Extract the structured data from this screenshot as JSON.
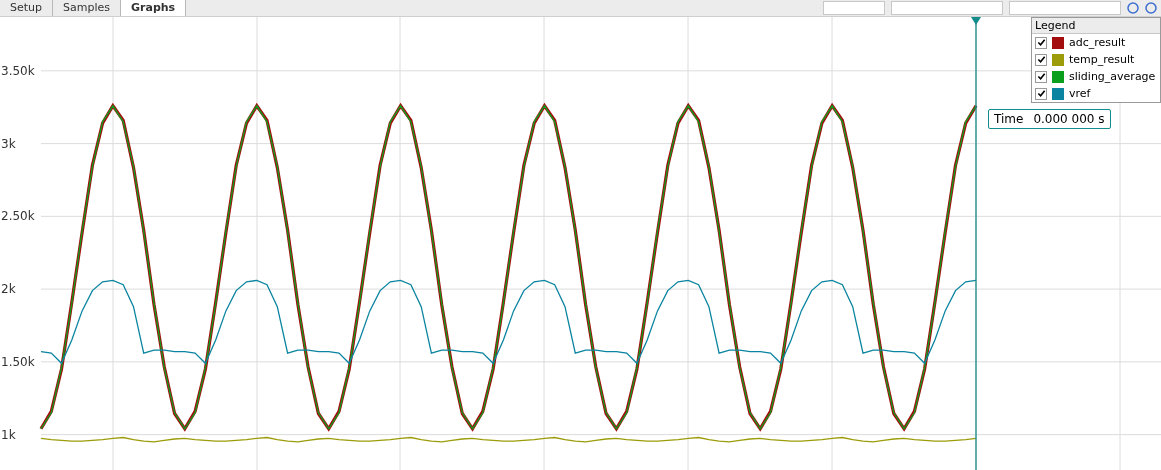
{
  "tabs": [
    {
      "label": "Setup",
      "selected": false
    },
    {
      "label": "Samples",
      "selected": false
    },
    {
      "label": "Graphs",
      "selected": true
    }
  ],
  "legend": {
    "title": "Legend",
    "items": [
      {
        "checked": true
      },
      {
        "checked": true
      },
      {
        "checked": true
      },
      {
        "checked": true
      }
    ]
  },
  "cursor": {
    "label": "Time",
    "value": "0.000 000 s"
  },
  "chart_data": {
    "type": "line",
    "grid": true,
    "ylim": [
      750,
      3870
    ],
    "yticks": [
      {
        "value": 1000,
        "label": "1k"
      },
      {
        "value": 1500,
        "label": "1.50k"
      },
      {
        "value": 2000,
        "label": "2k"
      },
      {
        "value": 2500,
        "label": "2.50k"
      },
      {
        "value": 3000,
        "label": "3k"
      },
      {
        "value": 3500,
        "label": "3.50k"
      }
    ],
    "series": [
      {
        "name": "adc_result",
        "color": "#a30d0d",
        "values": [
          1040,
          1160,
          1450,
          1910,
          2390,
          2850,
          3140,
          3260,
          3160,
          2835,
          2405,
          1895,
          1465,
          1145,
          1040,
          1160,
          1450,
          1910,
          2390,
          2850,
          3140,
          3260,
          3160,
          2835,
          2405,
          1895,
          1465,
          1145,
          1040,
          1160,
          1450,
          1910,
          2390,
          2850,
          3140,
          3260,
          3160,
          2835,
          2405,
          1895,
          1465,
          1145,
          1040,
          1160,
          1450,
          1910,
          2390,
          2850,
          3140,
          3260,
          3160,
          2835,
          2405,
          1895,
          1465,
          1145,
          1040,
          1160,
          1450,
          1910,
          2390,
          2850,
          3140,
          3260,
          3160,
          2835,
          2405,
          1895,
          1465,
          1145,
          1040,
          1160,
          1450,
          1910,
          2390,
          2850,
          3140,
          3260,
          3160,
          2835,
          2405,
          1895,
          1465,
          1145,
          1040,
          1160,
          1450,
          1910,
          2390,
          2850,
          3140,
          3260
        ]
      },
      {
        "name": "temp_result",
        "color": "#9c9c0a",
        "values": [
          975,
          965,
          960,
          955,
          955,
          960,
          965,
          975,
          980,
          965,
          955,
          950,
          960,
          970,
          975,
          965,
          960,
          955,
          955,
          960,
          965,
          975,
          980,
          965,
          955,
          950,
          960,
          970,
          975,
          965,
          960,
          955,
          955,
          960,
          965,
          975,
          980,
          965,
          955,
          950,
          960,
          970,
          975,
          965,
          960,
          955,
          955,
          960,
          965,
          975,
          980,
          965,
          955,
          950,
          960,
          970,
          975,
          965,
          960,
          955,
          955,
          960,
          965,
          975,
          980,
          965,
          955,
          950,
          960,
          970,
          975,
          965,
          960,
          955,
          955,
          960,
          965,
          975,
          980,
          965,
          955,
          950,
          960,
          970,
          975,
          965,
          960,
          955,
          955,
          960,
          965,
          975
        ]
      },
      {
        "name": "sliding_average",
        "color": "#0aa01e",
        "values": [
          1040,
          1150,
          1458,
          1902,
          2398,
          2842,
          3150,
          3260,
          3150,
          2842,
          2398,
          1902,
          1458,
          1150,
          1040,
          1150,
          1458,
          1902,
          2398,
          2842,
          3150,
          3260,
          3150,
          2842,
          2398,
          1902,
          1458,
          1150,
          1040,
          1150,
          1458,
          1902,
          2398,
          2842,
          3150,
          3260,
          3150,
          2842,
          2398,
          1902,
          1458,
          1150,
          1040,
          1150,
          1458,
          1902,
          2398,
          2842,
          3150,
          3260,
          3150,
          2842,
          2398,
          1902,
          1458,
          1150,
          1040,
          1150,
          1458,
          1902,
          2398,
          2842,
          3150,
          3260,
          3150,
          2842,
          2398,
          1902,
          1458,
          1150,
          1040,
          1150,
          1458,
          1902,
          2398,
          2842,
          3150,
          3260,
          3150,
          2842,
          2398,
          1902,
          1458,
          1150,
          1040,
          1150,
          1458,
          1902,
          2398,
          2842,
          3150,
          3260
        ]
      },
      {
        "name": "vref",
        "color": "#0a84a0",
        "values": [
          1570,
          1560,
          1490,
          1650,
          1850,
          1990,
          2050,
          2060,
          2030,
          1880,
          1560,
          1580,
          1580,
          1570,
          1570,
          1560,
          1490,
          1650,
          1850,
          1990,
          2050,
          2060,
          2030,
          1880,
          1560,
          1580,
          1580,
          1570,
          1570,
          1560,
          1490,
          1650,
          1850,
          1990,
          2050,
          2060,
          2030,
          1880,
          1560,
          1580,
          1580,
          1570,
          1570,
          1560,
          1490,
          1650,
          1850,
          1990,
          2050,
          2060,
          2030,
          1880,
          1560,
          1580,
          1580,
          1570,
          1570,
          1560,
          1490,
          1650,
          1850,
          1990,
          2050,
          2060,
          2030,
          1880,
          1560,
          1580,
          1580,
          1570,
          1570,
          1560,
          1490,
          1650,
          1850,
          1990,
          2050,
          2060,
          2030,
          1880,
          1560,
          1580,
          1580,
          1570,
          1570,
          1560,
          1490,
          1650,
          1850,
          1990,
          2050,
          2060
        ]
      }
    ]
  }
}
